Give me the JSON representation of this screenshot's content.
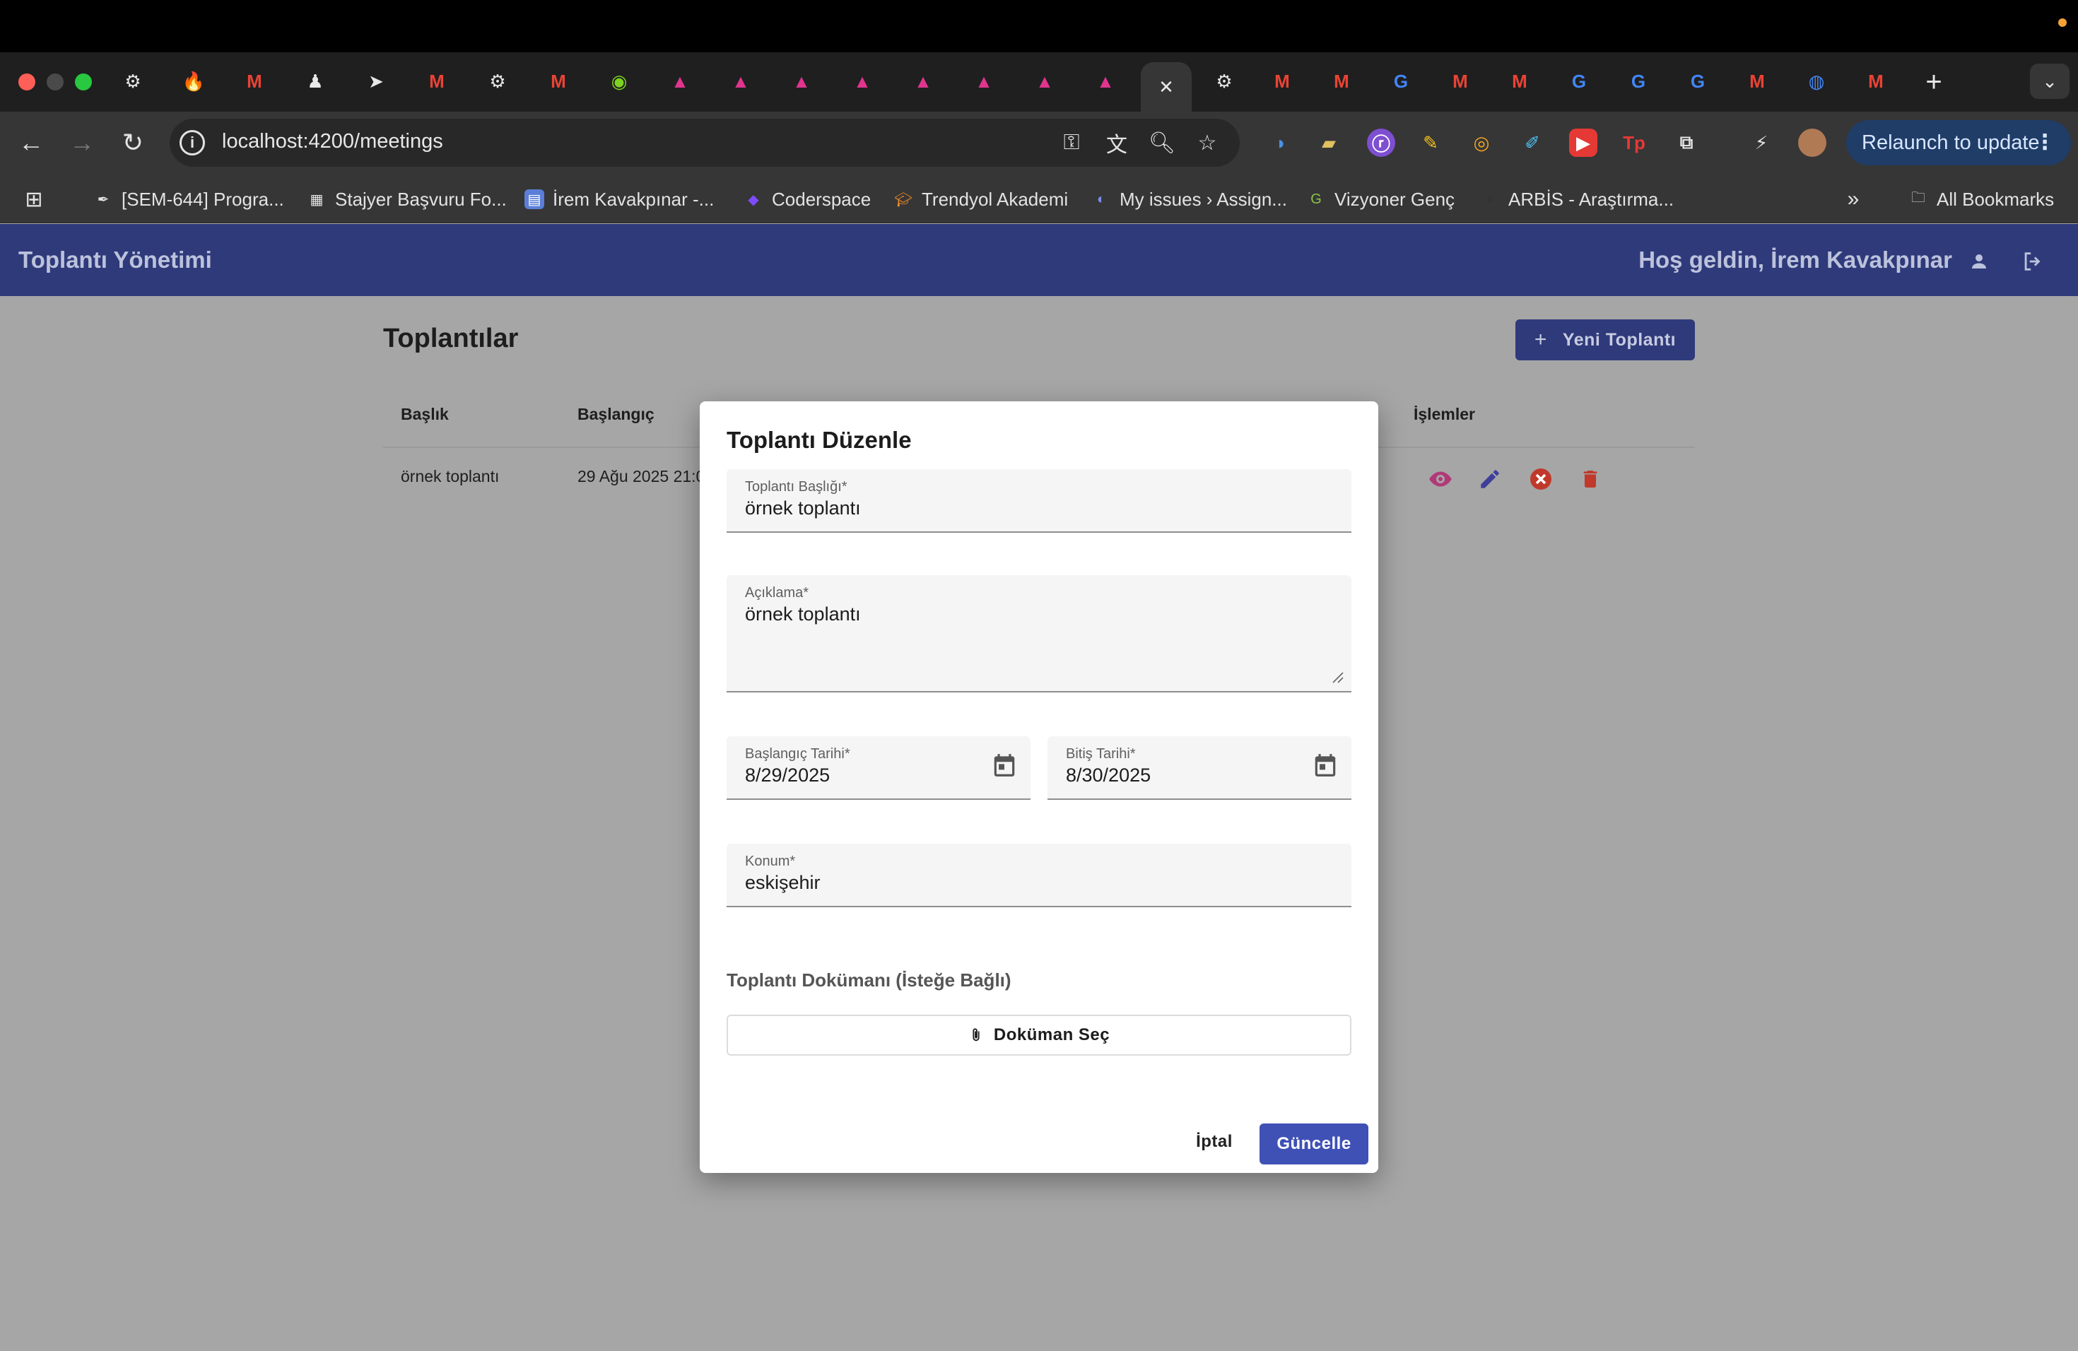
{
  "browser": {
    "url": "localhost:4200/meetings",
    "relaunch_label": "Relaunch to update",
    "active_tab_close": "✕",
    "bookmarks": [
      {
        "label": "[SEM-644] Progra..."
      },
      {
        "label": "Stajyer Başvuru Fo..."
      },
      {
        "label": "İrem Kavakpınar -..."
      },
      {
        "label": "Coderspace"
      },
      {
        "label": "Trendyol Akademi"
      },
      {
        "label": "My issues › Assign..."
      },
      {
        "label": "Vizyoner Genç"
      },
      {
        "label": "ARBİS - Araştırma..."
      }
    ],
    "all_bookmarks_label": "All Bookmarks"
  },
  "app": {
    "title": "Toplantı Yönetimi",
    "welcome": "Hoş geldin, İrem Kavakpınar"
  },
  "page": {
    "title": "Toplantılar",
    "new_meeting_label": "Yeni Toplantı",
    "columns": {
      "title": "Başlık",
      "start": "Başlangıç",
      "actions": "İşlemler"
    },
    "rows": [
      {
        "title": "örnek toplantı",
        "start": "29 Ağu 2025 21:0"
      }
    ]
  },
  "dialog": {
    "title": "Toplantı Düzenle",
    "meeting_title_label": "Toplantı Başlığı*",
    "meeting_title_value": "örnek toplantı",
    "description_label": "Açıklama*",
    "description_value": "örnek toplantı",
    "start_date_label": "Başlangıç Tarihi*",
    "start_date_value": "8/29/2025",
    "end_date_label": "Bitiş Tarihi*",
    "end_date_value": "8/30/2025",
    "location_label": "Konum*",
    "location_value": "eskişehir",
    "document_label": "Toplantı Dokümanı (İsteğe Bağlı)",
    "choose_document_label": "Doküman Seç",
    "cancel_label": "İptal",
    "update_label": "Güncelle"
  },
  "colors": {
    "header": "#2f3a7b",
    "primary": "#3f51b5",
    "view_icon": "#b03a78",
    "edit_icon": "#3f3f9a",
    "cancel_icon": "#c0392b",
    "delete_icon": "#c0392b"
  }
}
